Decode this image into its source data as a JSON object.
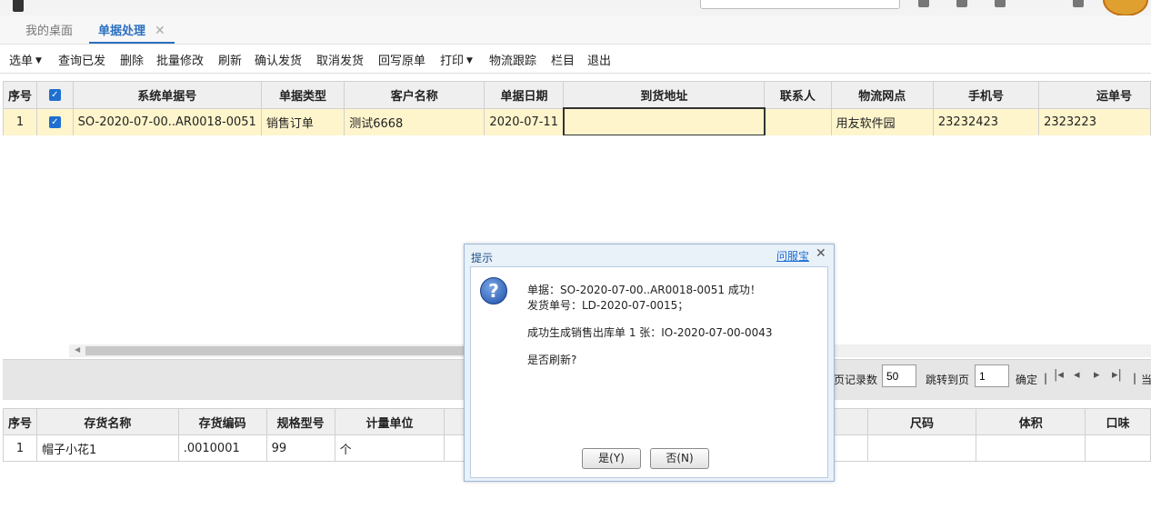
{
  "tabs": [
    {
      "label": "我的桌面"
    },
    {
      "label": "单据处理",
      "close": "✕"
    }
  ],
  "toolbar": {
    "select": "选单",
    "query_shipped": "查询已发",
    "delete": "删除",
    "batch_edit": "批量修改",
    "refresh": "刷新",
    "confirm_ship": "确认发货",
    "cancel_ship": "取消发货",
    "writeback": "回写原单",
    "print": "打印",
    "logistics": "物流跟踪",
    "columns": "栏目",
    "exit": "退出"
  },
  "main_grid": {
    "columns": [
      "序号",
      "",
      "系统单据号",
      "单据类型",
      "客户名称",
      "单据日期",
      "到货地址",
      "联系人",
      "物流网点",
      "手机号",
      "运单号"
    ],
    "rows": [
      {
        "seq": "1",
        "checked": true,
        "doc_no": "SO-2020-07-00..AR0018-0051",
        "doc_type": "销售订单",
        "customer": "测试6668",
        "date": "2020-07-11",
        "address": "",
        "contact": "",
        "logistics_point": "用友软件园",
        "phone": "23232423",
        "waybill": "2323223"
      }
    ]
  },
  "pager": {
    "page_size_label": "页记录数",
    "page_size": "50",
    "jump_label": "跳转到页",
    "page": "1",
    "confirm": "确定",
    "sep1": "|",
    "sep2": "|",
    "current_label": "当"
  },
  "detail_grid": {
    "columns": [
      "序号",
      "存货名称",
      "存货编码",
      "规格型号",
      "计量单位",
      "",
      "尺码",
      "体积",
      "口味"
    ],
    "rows": [
      {
        "seq": "1",
        "name": "帽子小花1",
        "code": ".0010001",
        "spec": "99",
        "unit": "个"
      }
    ]
  },
  "dialog": {
    "title": "提示",
    "help_link": "问服宝",
    "close": "✕",
    "line1": "单据：SO-2020-07-00..AR0018-0051 成功！",
    "line2": "发货单号：LD-2020-07-0015；",
    "line3": "成功生成销售出库单 1 张：IO-2020-07-00-0043",
    "line4": "是否刷新?",
    "yes_button": "是(Y)",
    "no_button": "否(N)"
  },
  "colors": {
    "accent": "#2a6fc0",
    "selected_row": "#fff5cc",
    "dialog_frame": "#e9f1f9"
  }
}
